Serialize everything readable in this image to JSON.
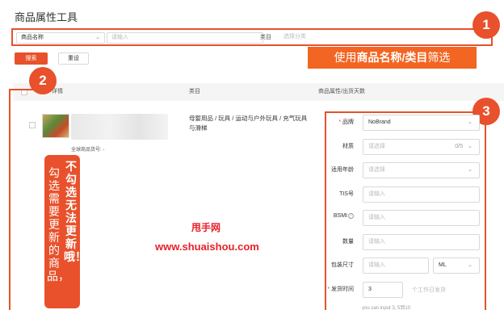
{
  "page": {
    "title": "商品属性工具"
  },
  "filter": {
    "name_select": "商品名称",
    "name_input_placeholder": "请输入",
    "category_label": "类目",
    "category_placeholder": "选择分类"
  },
  "actions": {
    "search_label": "搜索",
    "reset_label": "重设"
  },
  "annotations": {
    "badge_1": "1",
    "badge_2": "2",
    "badge_3": "3",
    "filter_tip_prefix": "使用",
    "filter_tip_bold": "商品名称/类目",
    "filter_tip_suffix": "筛选",
    "checkbox_tip_a": "不勾选无法更新哦！",
    "checkbox_tip_b": "勾选需要更新的商品，",
    "colors": {
      "accent": "#e8512b",
      "tip_bg": "#f26522",
      "watermark": "#e8202a"
    }
  },
  "table": {
    "headers": [
      "详情",
      "类目",
      "商品属性/出货天数"
    ]
  },
  "product": {
    "global_id": "全球商品货号: -",
    "category_path": "母婴用品 / 玩具 / 运动与户外玩具 / 充气玩具与滑梯"
  },
  "attributes": {
    "brand": {
      "label": "品牌",
      "value": "NoBrand"
    },
    "material": {
      "label": "材质",
      "placeholder": "请选择",
      "count": "0/5"
    },
    "age": {
      "label": "适用年龄",
      "placeholder": "请选择"
    },
    "tis": {
      "label": "TIS号",
      "placeholder": "请输入"
    },
    "bsmi": {
      "label": "BSMI",
      "placeholder": "请输入"
    },
    "qty": {
      "label": "数量",
      "placeholder": "请输入"
    },
    "pkg": {
      "label": "包装尺寸",
      "placeholder": "请输入",
      "unit": "ML"
    },
    "ship": {
      "label": "发货时间",
      "value": "3",
      "unit": "个工作日发货",
      "hint": "you can input 3, 5到10"
    }
  },
  "watermark": {
    "line1": "甩手网",
    "line2": "www.shuaishou.com"
  }
}
